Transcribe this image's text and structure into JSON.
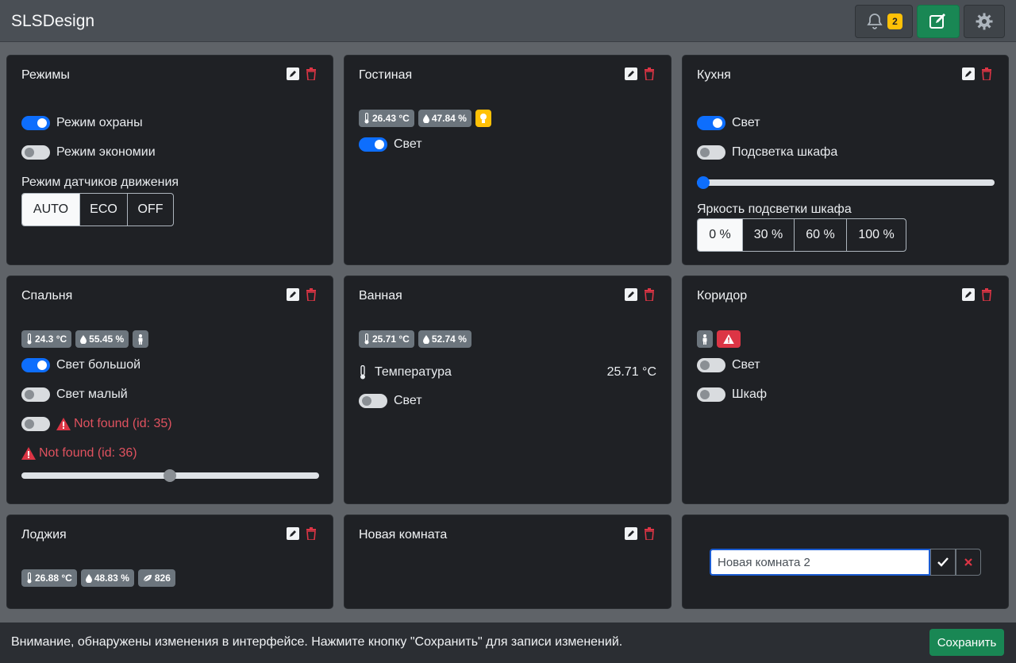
{
  "app": {
    "title": "SLSDesign",
    "notifications_count": "2"
  },
  "cards": {
    "modes": {
      "title": "Режимы",
      "security": "Режим охраны",
      "economy": "Режим экономии",
      "motion_label": "Режим датчиков движения",
      "motion_options": [
        "AUTO",
        "ECO",
        "OFF"
      ],
      "motion_selected": "AUTO"
    },
    "living": {
      "title": "Гостиная",
      "temp": "26.43 °C",
      "humidity": "47.84 %",
      "light": "Свет"
    },
    "kitchen": {
      "title": "Кухня",
      "light": "Свет",
      "cabinet_light": "Подсветка шкафа",
      "brightness_label": "Яркость подсветки шкафа",
      "brightness_options": [
        "0 %",
        "30 %",
        "60 %",
        "100 %"
      ],
      "brightness_selected": "0 %",
      "slider_value": 0
    },
    "bedroom": {
      "title": "Спальня",
      "temp": "24.3 °C",
      "humidity": "55.45 %",
      "big_light": "Свет большой",
      "small_light": "Свет малый",
      "not_found_35": "Not found (id: 35)",
      "not_found_36": "Not found (id: 36)",
      "slider_value": 0.5
    },
    "bathroom": {
      "title": "Ванная",
      "temp": "25.71 °C",
      "humidity": "52.74 %",
      "temp_label": "Температура",
      "temp_value": "25.71 °C",
      "light": "Свет"
    },
    "corridor": {
      "title": "Коридор",
      "light": "Свет",
      "wardrobe": "Шкаф"
    },
    "loggia": {
      "title": "Лоджия",
      "temp": "26.88 °C",
      "humidity": "48.83 %",
      "co2": "826"
    },
    "new_room": {
      "title": "Новая комната"
    },
    "add_room": {
      "input_value": "Новая комната 2"
    }
  },
  "footer": {
    "message": "Внимание, обнаружены изменения в интерфейсе. Нажмите кнопку \"Сохранить\" для записи изменений.",
    "save_label": "Сохранить"
  },
  "colors": {
    "accent": "#0d6efd",
    "success": "#198754",
    "danger": "#dc3545",
    "warning": "#ffc107",
    "card_bg": "#1f2125"
  }
}
